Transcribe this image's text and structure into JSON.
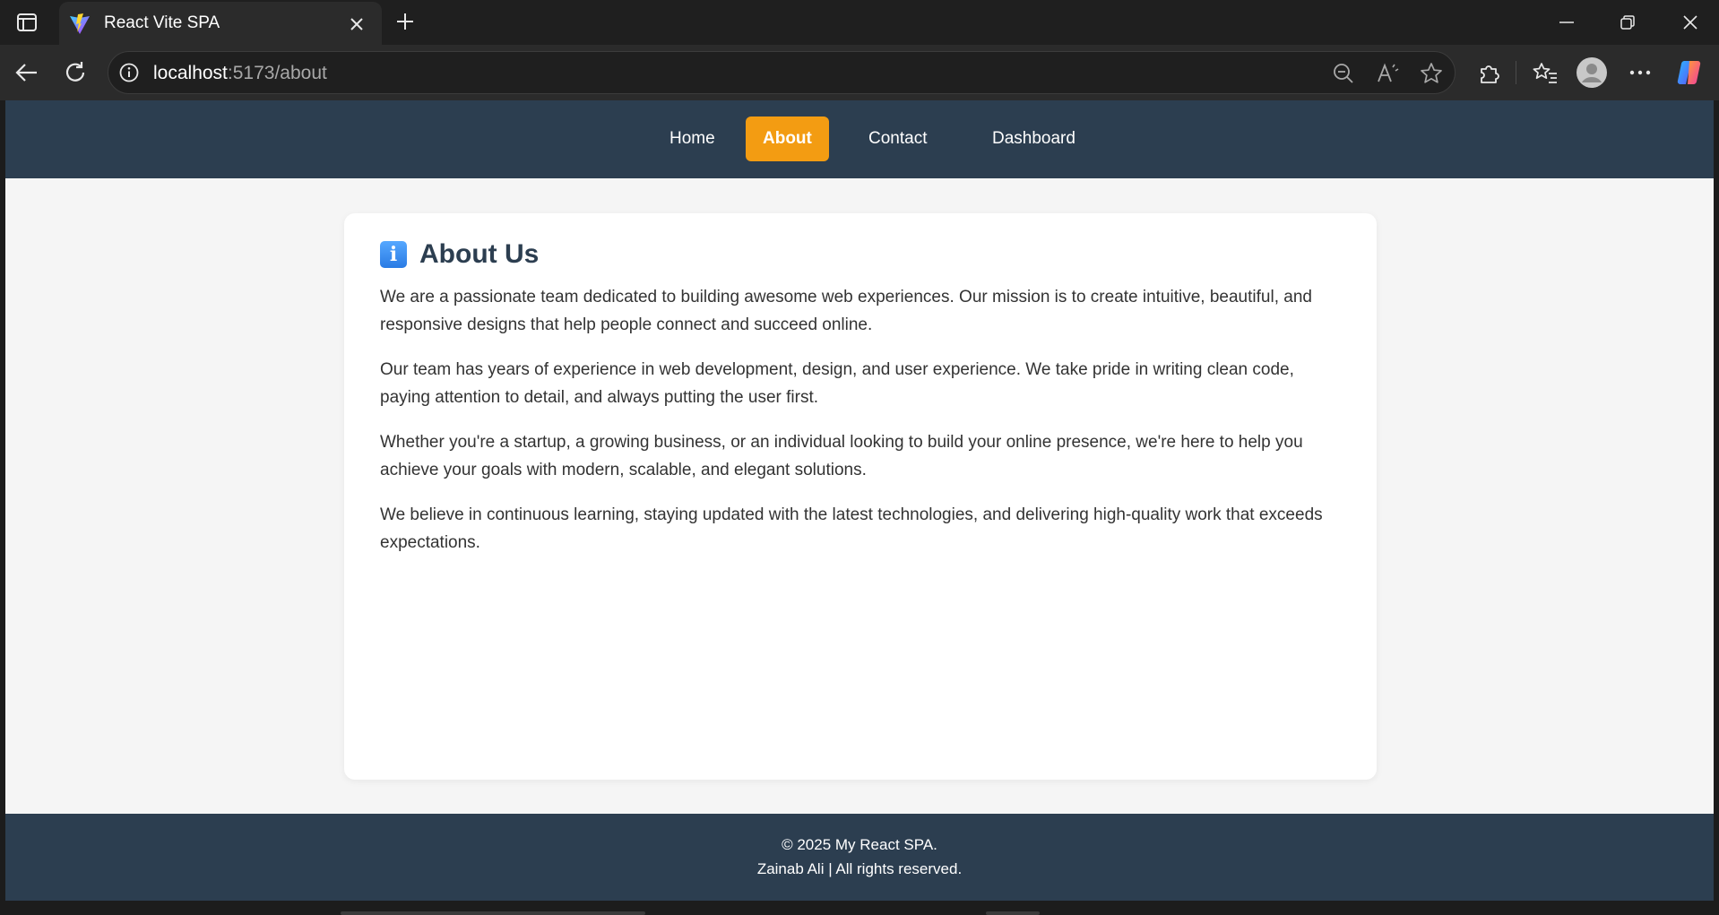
{
  "browser": {
    "tab_title": "React Vite SPA",
    "url_host": "localhost",
    "url_rest": ":5173/about",
    "icons": {
      "sidebar": "tab-actions-icon",
      "favicon": "vite-logo-icon",
      "close": "close-icon",
      "new_tab": "plus-icon",
      "back": "back-arrow-icon",
      "refresh": "refresh-icon",
      "info": "info-icon",
      "zoom": "zoom-out-icon",
      "read_aloud": "read-aloud-icon",
      "favorite": "star-icon",
      "extensions": "puzzle-icon",
      "favorites": "favorites-icon",
      "profile": "avatar-icon",
      "more": "more-icon",
      "copilot": "copilot-icon"
    }
  },
  "nav": {
    "items": [
      {
        "label": "Home",
        "active": false
      },
      {
        "label": "About",
        "active": true
      },
      {
        "label": "Contact",
        "active": false
      },
      {
        "label": "Dashboard",
        "active": false
      }
    ]
  },
  "content": {
    "icon": "i",
    "title": "About Us",
    "paragraphs": [
      "We are a passionate team dedicated to building awesome web experiences. Our mission is to create intuitive, beautiful, and responsive designs that help people connect and succeed online.",
      "Our team has years of experience in web development, design, and user experience. We take pride in writing clean code, paying attention to detail, and always putting the user first.",
      "Whether you're a startup, a growing business, or an individual looking to build your online presence, we're here to help you achieve your goals with modern, scalable, and elegant solutions.",
      "We believe in continuous learning, staying updated with the latest technologies, and delivering high-quality work that exceeds expectations."
    ]
  },
  "footer": {
    "line1": "© 2025 My React SPA.",
    "line2": "Zainab Ali | All rights reserved."
  },
  "colors": {
    "nav_bg": "#2c3e50",
    "accent": "#f39c12",
    "page_bg": "#f5f5f5",
    "card_bg": "#ffffff",
    "title": "#2c3e50"
  }
}
